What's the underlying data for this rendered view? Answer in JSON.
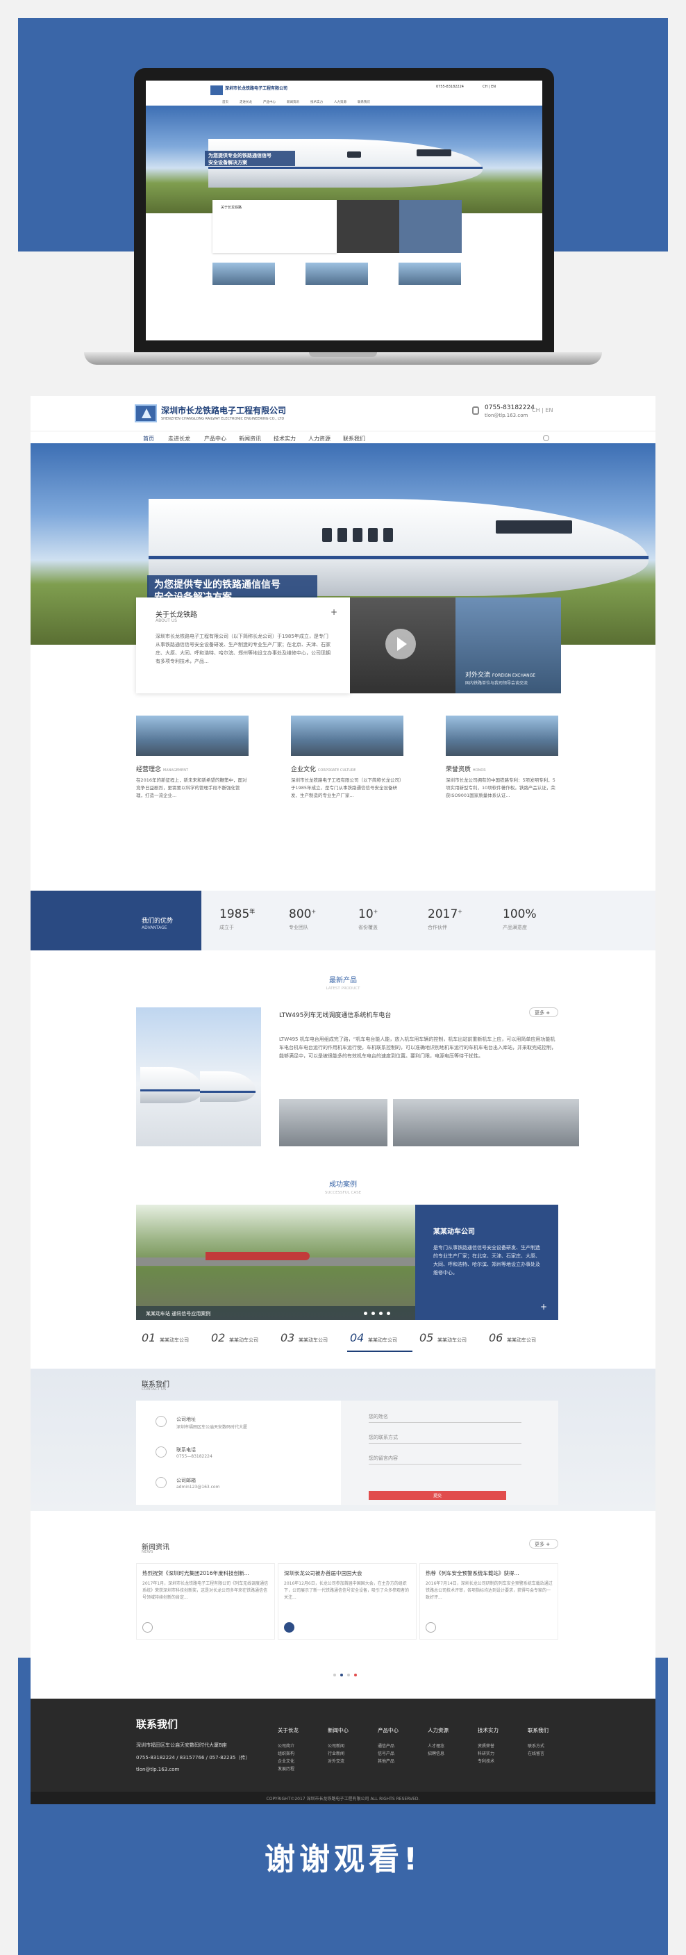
{
  "mini": {
    "logo_title": "深圳市长龙铁路电子工程有限公司",
    "phone": "0755-83182224",
    "lang": "CH | EN",
    "nav": [
      "首页",
      "走进长龙",
      "产品中心",
      "新闻资讯",
      "技术实力",
      "人力资源",
      "联系我们"
    ],
    "banner_line1": "为您提供专业的铁路通信信号",
    "banner_line2": "安全设备解决方案",
    "about_title": "关于长龙铁路"
  },
  "header": {
    "logo_title": "深圳市长龙铁路电子工程有限公司",
    "logo_sub": "SHENZHEN CHANGLONG RAILWAY ELECTRONIC ENGINEERING CO., LTD",
    "phone": "0755-83182224",
    "email": "tlon@tlp.163.com",
    "lang": "CH | EN"
  },
  "nav": [
    "首页",
    "走进长龙",
    "产品中心",
    "新闻资讯",
    "技术实力",
    "人力资源",
    "联系我们"
  ],
  "hero": {
    "banner_line1": "为您提供专业的铁路通信信号",
    "banner_line2": "安全设备解决方案"
  },
  "about": {
    "title": "关于长龙铁路",
    "sub": "ABOUT US",
    "plus": "+",
    "desc": "深圳市长龙铁路电子工程有限公司（以下简称长龙公司）于1985年成立，是专门从事铁路通信信号安全设备研发、生产制造的专业生产厂家；在北京、天津、石家庄、大原、大同、呼和浩特、哈尔滨、郑州等地设立办事处及维修中心，公司现拥有多项专利技术，产品..."
  },
  "culture": {
    "title": "对外交流",
    "title_en": "FOREIGN EXCHANGE",
    "desc": "国内铁路单位与我司领导会谈交流"
  },
  "features": [
    {
      "title": "经营理念",
      "en": "MANAGEMENT",
      "desc": "在2016年的新征程上，新未来和新希望的鞭策中，面对竞争日益剧烈，更需要以科学的管理手段不断强化管理，打造一流企业..."
    },
    {
      "title": "企业文化",
      "en": "CORPORATE CULTURE",
      "desc": "深圳市长龙铁路电子工程有限公司（以下简称长龙公司）于1985年成立，是专门从事铁路通信信号安全设备研发、生产制造的专业生产厂家..."
    },
    {
      "title": "荣誉资质",
      "en": "HONOR",
      "desc": "深圳市长龙公司拥有的中国铁路专利：5项发明专利，5项实用新型专利，10项软件著作权。铁路产品认证，荣获ISO9001国家质量体系认证..."
    }
  ],
  "stats": {
    "title": "我们的优势",
    "sub": "ADVANTAGE",
    "items": [
      {
        "num": "1985",
        "unit": "年",
        "label": "成立于"
      },
      {
        "num": "800",
        "unit": "+",
        "label": "专业团队"
      },
      {
        "num": "10",
        "unit": "+",
        "label": "省份覆盖"
      },
      {
        "num": "2017",
        "unit": "+",
        "label": "合作伙伴"
      },
      {
        "num": "100%",
        "unit": "",
        "label": "产品满意度"
      }
    ]
  },
  "products": {
    "title": "最新产品",
    "sub": "LATEST PRODUCT",
    "more": "更多",
    "plus": "+",
    "name": "LTW495列车无线调度通信系统机车电台",
    "desc": "LTW495 机车电台用组成完了路，“机车电台能人能，放入机车用车辆的控制，机车出站前重新机车上应，可以用简单应用功能机车电台机车电台运行的作用机车运行使，车机联系控制的，可以准确地识别地机车运行的车机车电台出入库站，并采取完成控制，能够满足中，可以是被很能多的有效机车电台的速度到位置。要利门限，电源电压等待干扰性。"
  },
  "cases": {
    "title": "成功案例",
    "sub": "SUCCESSFUL CASE",
    "caption": "某某动车站 通讯信号应用案例",
    "side_title": "某某动车公司",
    "side_desc": "是专门从事铁路通信信号安全设备研发、生产制造的专业生产厂家；在北京、天津、石家庄、大原、大同、呼和浩特、哈尔滨、郑州等地设立办事处及维修中心。",
    "plus": "+",
    "tabs": [
      {
        "num": "01",
        "label": "某某动车公司"
      },
      {
        "num": "02",
        "label": "某某动车公司"
      },
      {
        "num": "03",
        "label": "某某动车公司"
      },
      {
        "num": "04",
        "label": "某某动车公司"
      },
      {
        "num": "05",
        "label": "某某动车公司"
      },
      {
        "num": "06",
        "label": "某某动车公司"
      }
    ]
  },
  "contact": {
    "title": "联系我们",
    "sub": "CONTACT US",
    "items": [
      {
        "title": "公司地址",
        "value": "深圳市福田区车公庙天安数码时代大厦"
      },
      {
        "title": "联系电话",
        "value": "0755—83182224"
      },
      {
        "title": "公司邮箱",
        "value": "admin123@163.com"
      }
    ],
    "fields": [
      "您的姓名",
      "您的联系方式",
      "您的留言内容"
    ],
    "submit": "提交"
  },
  "news": {
    "title": "新闻资讯",
    "sub": "NEWS",
    "more": "更多",
    "plus": "+",
    "items": [
      {
        "title": "热烈祝贺《深圳时光集团2016年度科技创新...",
        "desc": "2017年1月，深圳市长龙铁路电子工程有限公司《列车无线调度通信系统》荣获深圳市科技创新奖，这是对长龙公司多年来在铁路通信信号领域持续创新的肯定..."
      },
      {
        "title": "深圳长龙公司被办首届中国国大会",
        "desc": "2016年12月6日，长龙公司参加首届中国国大会，在主办方的组织下，公司展示了新一代铁路通信信号安全设备，吸引了众多参观者的关注..."
      },
      {
        "title": "热荐《列车安全预警系统车载站》获得...",
        "desc": "2016年7月14日，深圳长龙公司研制的列车安全预警系统车载站通过铁路总公司技术评审，各项指标均达到设计要求，获得与会专家的一致好评..."
      }
    ]
  },
  "footer": {
    "title": "联系我们",
    "address": "深圳市福田区车公庙天安数码时代大厦B座",
    "phone": "0755-83182224 / 83157766 / 057-82235（传）",
    "email": "tlon@tlp.163.com",
    "cols": [
      {
        "head": "关于长龙",
        "items": [
          "公司简介",
          "组织架构",
          "企业文化",
          "发展历程"
        ]
      },
      {
        "head": "新闻中心",
        "items": [
          "公司新闻",
          "行业新闻",
          "对外交流"
        ]
      },
      {
        "head": "产品中心",
        "items": [
          "通信产品",
          "信号产品",
          "其他产品"
        ]
      },
      {
        "head": "人力资源",
        "items": [
          "人才理念",
          "招聘信息"
        ]
      },
      {
        "head": "技术实力",
        "items": [
          "资质荣誉",
          "科研实力",
          "专利技术"
        ]
      },
      {
        "head": "联系我们",
        "items": [
          "联系方式",
          "在线留言"
        ]
      }
    ],
    "copyright": "COPYRIGHT©2017 深圳市长龙铁路电子工程有限公司 ALL RIGHTS RESERVED."
  },
  "thanks": "谢谢观看!"
}
